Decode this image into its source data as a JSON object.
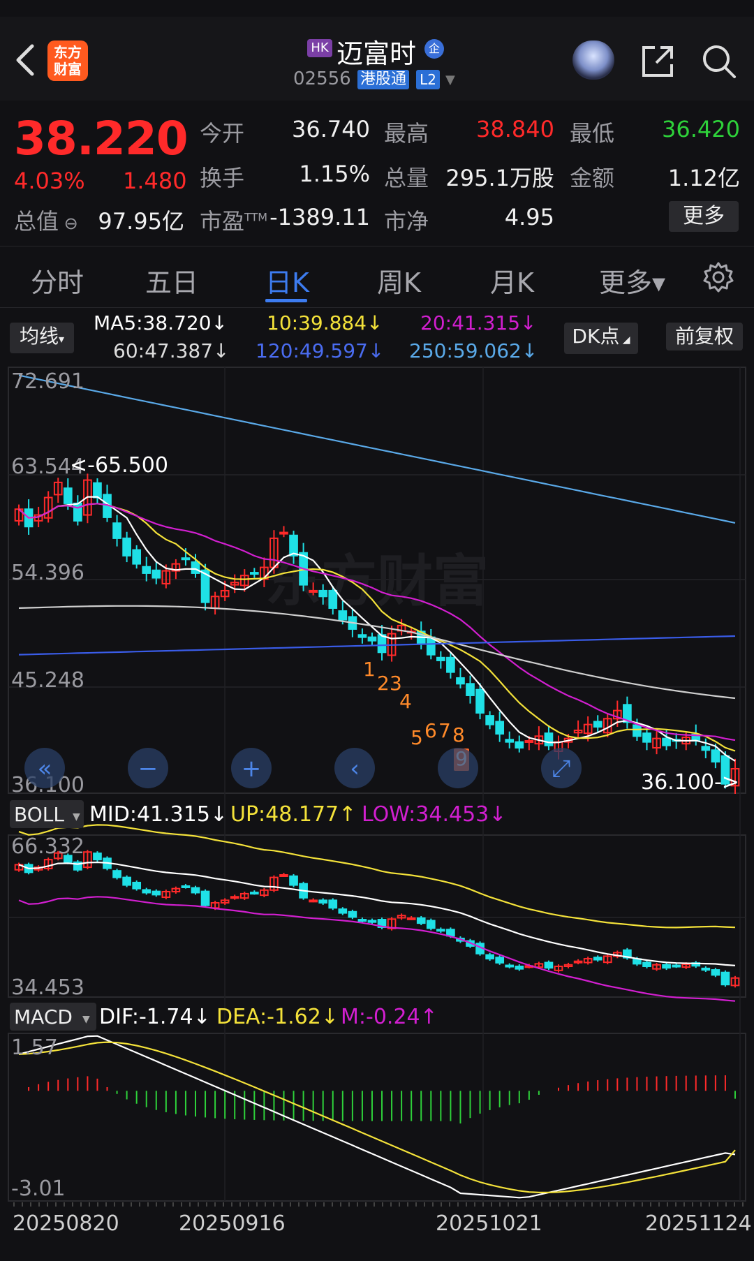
{
  "header": {
    "back_icon": "chevron-left-icon",
    "app_logo_text": [
      "东方",
      "财富"
    ],
    "market_badge": "HK",
    "stock_name": "迈富时",
    "enterprise_badge": "企",
    "stock_code": "02556",
    "connect_tag": "港股通",
    "level_tag": "L2"
  },
  "quote": {
    "price": "38.220",
    "change_pct": "4.03%",
    "change_amt": "1.480",
    "open_label": "今开",
    "open": "36.740",
    "high_label": "最高",
    "high": "38.840",
    "low_label": "最低",
    "low": "36.420",
    "turnover_label": "换手",
    "turnover": "1.15%",
    "volume_label": "总量",
    "volume": "295.1万股",
    "amount_label": "金额",
    "amount": "1.12亿",
    "mktcap_label": "总值",
    "mktcap": "97.95亿",
    "pe_label": "市盈",
    "pe_sup": "TTM",
    "pe": "-1389.11",
    "pb_label": "市净",
    "pb": "4.95",
    "more_button": "更多"
  },
  "tabs": [
    {
      "label": "分时"
    },
    {
      "label": "五日"
    },
    {
      "label": "日K",
      "active": true
    },
    {
      "label": "周K"
    },
    {
      "label": "月K"
    },
    {
      "label": "更多▾"
    }
  ],
  "ma_legend": {
    "indicator_button": "均线",
    "ma5": "MA5:38.720↓",
    "ma10": "10:39.884↓",
    "ma20": "20:41.315↓",
    "ma60": "60:47.387↓",
    "ma120": "120:49.597↓",
    "ma250": "250:59.062↓",
    "dk_button": "DK点",
    "adjust_button": "前复权"
  },
  "main_chart": {
    "y_labels": [
      "72.691",
      "63.544",
      "54.396",
      "45.248",
      "36.100"
    ],
    "max_marker": "<-65.500",
    "min_marker": "36.100->",
    "watermark": "东方财富",
    "td_numbers": [
      "1",
      "2",
      "3",
      "4",
      "5",
      "6",
      "7",
      "8",
      "9"
    ]
  },
  "boll": {
    "button": "BOLL",
    "mid": "MID:41.315↓",
    "up": "UP:48.177↑",
    "low": "LOW:34.453↓",
    "y_top": "66.332",
    "y_bottom": "34.453"
  },
  "macd": {
    "button": "MACD",
    "dif": "DIF:-1.74↓",
    "dea": "DEA:-1.62↓",
    "m": "M:-0.24↑",
    "y_top": "1.57",
    "y_bottom": "-3.01"
  },
  "x_axis": [
    "20250820",
    "20250916",
    "20251021",
    "20251124"
  ],
  "colors": {
    "up": "#ff2a2a",
    "down": "#1fe0e6",
    "ma5": "#ffffff",
    "ma10": "#f4e23a",
    "ma20": "#d21fd0",
    "ma60": "#cfcfcf",
    "ma120": "#3a5ce8",
    "ma250": "#5aa9e8",
    "accent": "#3d7cf0"
  },
  "chart_data": {
    "type": "candlestick",
    "period": "daily",
    "price_range": [
      36.1,
      72.691
    ],
    "last": {
      "open": 36.74,
      "high": 38.84,
      "low": 36.42,
      "close": 38.22
    },
    "period_high": 65.5,
    "period_low": 36.1,
    "moving_averages": {
      "MA5": 38.72,
      "MA10": 39.884,
      "MA20": 41.315,
      "MA60": 47.387,
      "MA120": 49.597,
      "MA250": 59.062
    },
    "closes": [
      60.5,
      59.0,
      60.0,
      61.5,
      62.8,
      61.0,
      59.5,
      63.0,
      61.5,
      59.8,
      58.0,
      56.5,
      55.8,
      55.0,
      54.6,
      55.2,
      55.8,
      56.2,
      55.0,
      52.5,
      53.0,
      53.5,
      54.2,
      54.8,
      55.0,
      55.5,
      58.0,
      58.5,
      56.5,
      54.0,
      53.5,
      53.0,
      52.0,
      51.0,
      50.2,
      49.5,
      49.2,
      48.2,
      49.8,
      50.5,
      50.0,
      49.0,
      48.0,
      47.5,
      46.5,
      45.5,
      44.5,
      43.0,
      42.0,
      41.2,
      40.5,
      40.0,
      40.6,
      41.0,
      40.2,
      40.5,
      40.8,
      41.5,
      42.0,
      41.8,
      42.5,
      43.2,
      42.2,
      41.0,
      40.5,
      40.8,
      40.2,
      40.6,
      40.9,
      40.6,
      39.8,
      38.8,
      36.9,
      38.2
    ],
    "boll": {
      "mid": 41.315,
      "up": 48.177,
      "low": 34.453,
      "range": [
        34.453,
        66.332
      ]
    },
    "macd": {
      "dif": -1.74,
      "dea": -1.62,
      "m": -0.24,
      "range": [
        -3.01,
        1.57
      ]
    }
  }
}
